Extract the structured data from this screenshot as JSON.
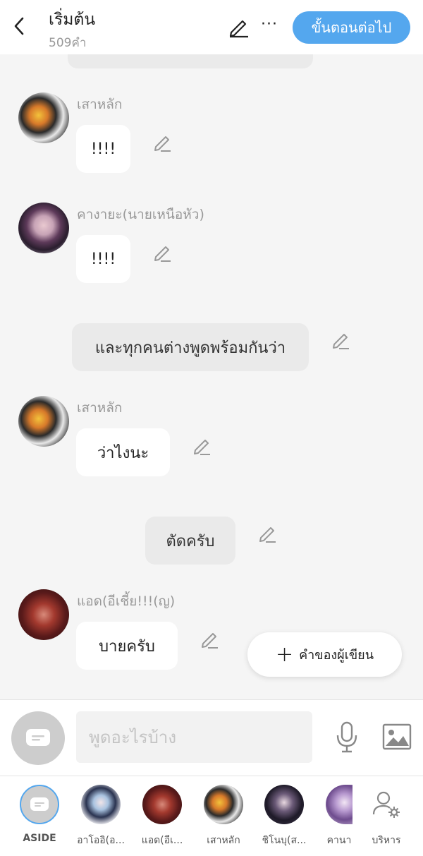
{
  "header": {
    "title": "เริ่มต้น",
    "word_count": "509คำ",
    "next_label": "ขั้นตอนต่อไป",
    "more_glyph": "···"
  },
  "chat": {
    "messages": [
      {
        "type": "character",
        "sender": "เสาหลัก",
        "text": "!!!!"
      },
      {
        "type": "character",
        "sender": "คางายะ(นายเหนือหัว)",
        "text": "!!!!"
      },
      {
        "type": "narration",
        "text": "และทุกคนต่างพูดพร้อมกันว่า"
      },
      {
        "type": "character",
        "sender": "เสาหลัก",
        "text": "ว่าไงนะ"
      },
      {
        "type": "narration",
        "text": "ตัดครับ"
      },
      {
        "type": "character",
        "sender": "แอด(อีเชี้ย!!!(ญ)",
        "text": "บายครับ"
      }
    ]
  },
  "fab": {
    "label": "คำของผู้เขียน",
    "icon": "plus-icon"
  },
  "composer": {
    "placeholder": "พูดอะไรบ้าง"
  },
  "characters": [
    {
      "name": "ASIDE"
    },
    {
      "name": "อาโออิ(อ..."
    },
    {
      "name": "แอด(อีเ..."
    },
    {
      "name": "เสาหลัก"
    },
    {
      "name": "ชิโนบุ(ส..."
    },
    {
      "name": "คานา"
    },
    {
      "name": "บริหาร"
    }
  ],
  "colors": {
    "accent": "#54a7ee",
    "bubble_bg": "#ffffff",
    "narration_bg": "#eaeaea",
    "chat_bg": "#f5f5f5"
  }
}
